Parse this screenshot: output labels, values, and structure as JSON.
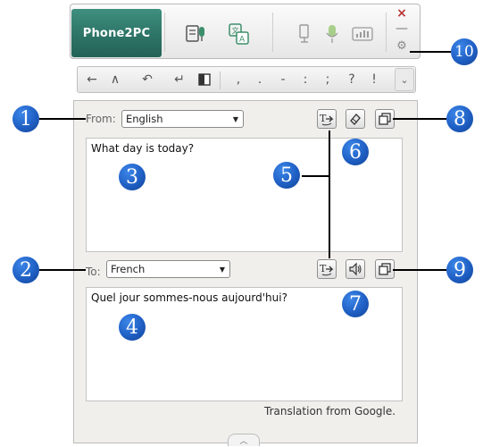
{
  "app": {
    "logo_text": "Phone2PC"
  },
  "toolbar": {
    "icons": [
      "speech-to-text-icon",
      "translate-icon",
      "edit-voice-icon",
      "microphone-icon",
      "sound-level-icon"
    ],
    "close_glyph": "×",
    "minimize_glyph": "—",
    "settings_glyph": "⚙"
  },
  "punctuation_bar": {
    "nav_buttons": [
      "←",
      "∧",
      "↶",
      "↵"
    ],
    "keys": [
      ",",
      ".",
      "-",
      ":",
      ";",
      "?",
      "!"
    ],
    "more": "⌄"
  },
  "from": {
    "label": "From:",
    "language": "English",
    "text": "What day is today?"
  },
  "to": {
    "label": "To:",
    "language": "French",
    "text": "Quel jour sommes-nous aujourd'hui?"
  },
  "credit": "Translation from Google.",
  "callouts": [
    "1",
    "2",
    "3",
    "4",
    "5",
    "6",
    "7",
    "8",
    "9",
    "10"
  ],
  "colors": {
    "logo_bg": "#2d7466",
    "callout": "#1f5fc4",
    "close": "#b93333"
  }
}
